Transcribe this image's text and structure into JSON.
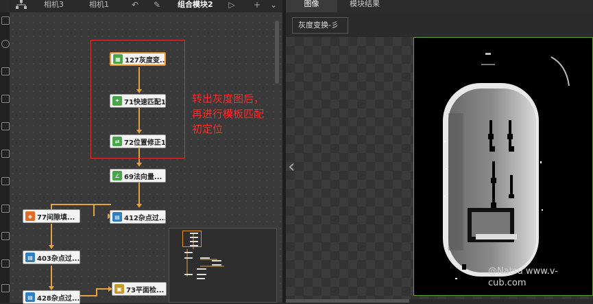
{
  "tabs": [
    {
      "label": "相机3",
      "active": false
    },
    {
      "label": "相机1",
      "active": false
    },
    {
      "label": "组合模块2",
      "active": true
    }
  ],
  "toolbar_icons": [
    "hierarchy-icon",
    "undo-icon",
    "wrench-icon",
    "play-icon",
    "add-icon",
    "chevron-down-icon"
  ],
  "nodes": [
    {
      "id": "n127",
      "label": "127灰度变...",
      "icon": "grayscale-icon",
      "color": "#4aa54a"
    },
    {
      "id": "n71",
      "label": "71快速匹配1",
      "icon": "match-icon",
      "color": "#4aa54a"
    },
    {
      "id": "n72",
      "label": "72位置修正1",
      "icon": "position-fix-icon",
      "color": "#4aa54a"
    },
    {
      "id": "n69",
      "label": "69法向量...",
      "icon": "normal-vector-icon",
      "color": "#4aa54a"
    },
    {
      "id": "n412",
      "label": "412杂点过...",
      "icon": "noise-filter-icon",
      "color": "#2f7fbf"
    },
    {
      "id": "n77",
      "label": "77间隙填...",
      "icon": "gap-fill-icon",
      "color": "#e06a2a"
    },
    {
      "id": "n403",
      "label": "403杂点过...",
      "icon": "noise-filter-icon",
      "color": "#2f7fbf"
    },
    {
      "id": "n428",
      "label": "428杂点过...",
      "icon": "noise-filter-icon",
      "color": "#2f7fbf"
    },
    {
      "id": "n73",
      "label": "73平面检...",
      "icon": "plane-check-icon",
      "color": "#c89a2a"
    }
  ],
  "annotation": "转出灰度图后，\n再进行模板匹配\n初定位",
  "right_tabs": [
    {
      "label": "图像",
      "active": true
    },
    {
      "label": "模块结果",
      "active": false
    }
  ],
  "image_select": {
    "value": "灰度变换-彡"
  },
  "watermark": "@Natsu www.v-cub.com",
  "colors": {
    "accent": "#e69326",
    "annotation": "#ff2a2a",
    "image_border": "#5aa02c"
  }
}
